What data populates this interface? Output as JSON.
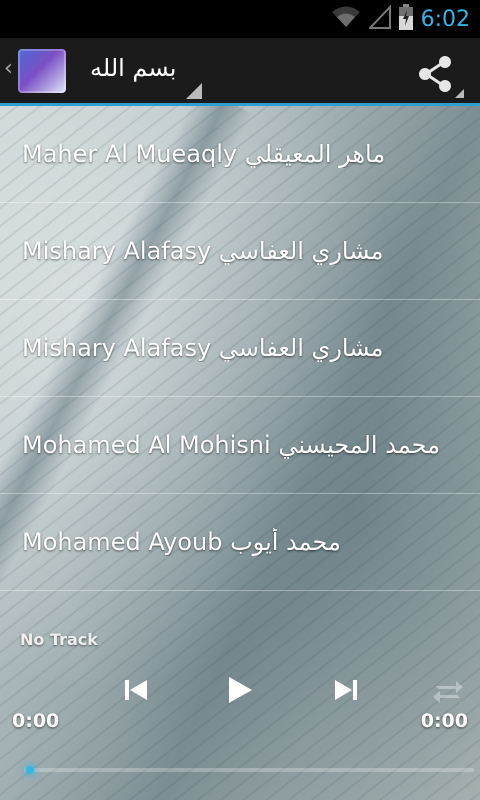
{
  "status_bar": {
    "time": "6:02"
  },
  "action_bar": {
    "title": "بسم الله"
  },
  "reciters": [
    {
      "label": "Maher Al Mueaqly ماهر المعيقلي"
    },
    {
      "label": "Mishary  Alafasy مشاري  العفاسي"
    },
    {
      "label": "Mishary  Alafasy مشاري  العفاسي"
    },
    {
      "label": "Mohamed Al Mohisni محمد المحيسني"
    },
    {
      "label": "Mohamed Ayoub محمد أيوب"
    }
  ],
  "player": {
    "track": "No Track",
    "elapsed": "0:00",
    "duration": "0:00",
    "progress": 0
  },
  "colors": {
    "accent": "#33b5e5",
    "actionbar_bg": "#1b1b1b",
    "divider": "#2f9fd0"
  },
  "icons": [
    "wifi-icon",
    "signal-icon",
    "battery-icon",
    "up-caret-icon",
    "app-icon",
    "share-icon",
    "previous-icon",
    "play-icon",
    "next-icon",
    "repeat-icon"
  ]
}
